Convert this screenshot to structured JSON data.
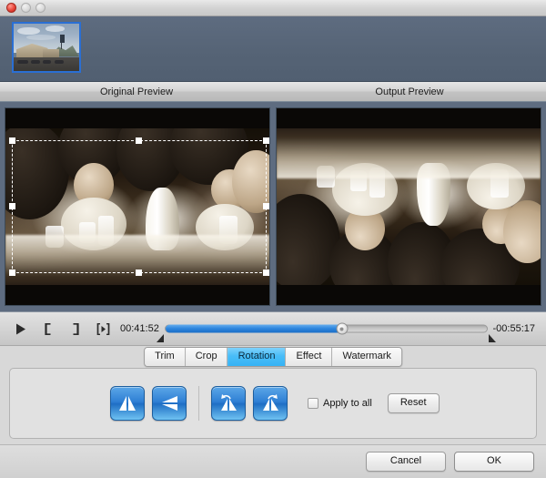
{
  "window": {
    "controls": {
      "close_label": "Close",
      "minimize_label": "Minimize",
      "zoom_label": "Zoom"
    }
  },
  "thumbnail_strip": {
    "items": [
      {
        "name": "video-thumbnail-1",
        "selected": true
      }
    ]
  },
  "previews": {
    "original_label": "Original Preview",
    "output_label": "Output Preview"
  },
  "transport": {
    "play_label": "Play",
    "set_start_label": "Set Start",
    "set_end_label": "Set End",
    "play_segment_label": "Play Segment",
    "current_time": "00:41:52",
    "remaining_time": "-00:55:17",
    "progress_percent": 55
  },
  "tabs": [
    {
      "label": "Trim",
      "active": false
    },
    {
      "label": "Crop",
      "active": false
    },
    {
      "label": "Rotation",
      "active": true
    },
    {
      "label": "Effect",
      "active": false
    },
    {
      "label": "Watermark",
      "active": false
    }
  ],
  "rotation_panel": {
    "buttons": [
      {
        "name": "flip-horizontal-button",
        "title": "Flip Horizontal"
      },
      {
        "name": "flip-vertical-button",
        "title": "Flip Vertical"
      },
      {
        "name": "rotate-left-button",
        "title": "Rotate Left 90"
      },
      {
        "name": "rotate-right-button",
        "title": "Rotate Right 90"
      }
    ],
    "apply_to_all_label": "Apply to all",
    "apply_to_all_checked": false,
    "reset_label": "Reset"
  },
  "footer": {
    "cancel_label": "Cancel",
    "ok_label": "OK"
  },
  "colors": {
    "accent_blue": "#2b84dd",
    "tab_active": "#36b3f5",
    "strip_bg": "#5e6c80",
    "panel_bg": "#e1e1e1"
  }
}
